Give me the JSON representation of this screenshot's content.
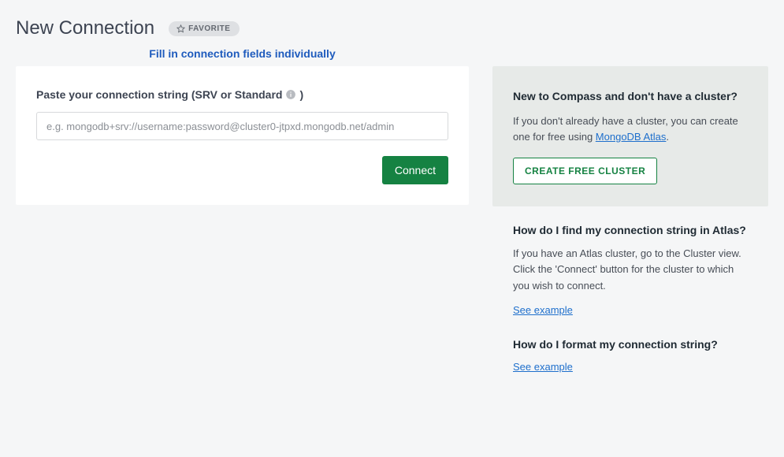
{
  "header": {
    "title": "New Connection",
    "favorite_label": "FAVORITE",
    "individual_link": "Fill in connection fields individually"
  },
  "form": {
    "label_prefix": "Paste your connection string (SRV or Standard",
    "label_suffix": ")",
    "placeholder": "e.g. mongodb+srv://username:password@cluster0-jtpxd.mongodb.net/admin",
    "connect_label": "Connect"
  },
  "help": {
    "card": {
      "heading": "New to Compass and don't have a cluster?",
      "text_before": "If you don't already have a cluster, you can create one for free using ",
      "atlas_link": "MongoDB Atlas",
      "text_after": ".",
      "button": "CREATE FREE CLUSTER"
    },
    "section1": {
      "heading": "How do I find my connection string in Atlas?",
      "text": "If you have an Atlas cluster, go to the Cluster view. Click the 'Connect' button for the cluster to which you wish to connect.",
      "link": "See example"
    },
    "section2": {
      "heading": "How do I format my connection string?",
      "link": "See example"
    }
  }
}
